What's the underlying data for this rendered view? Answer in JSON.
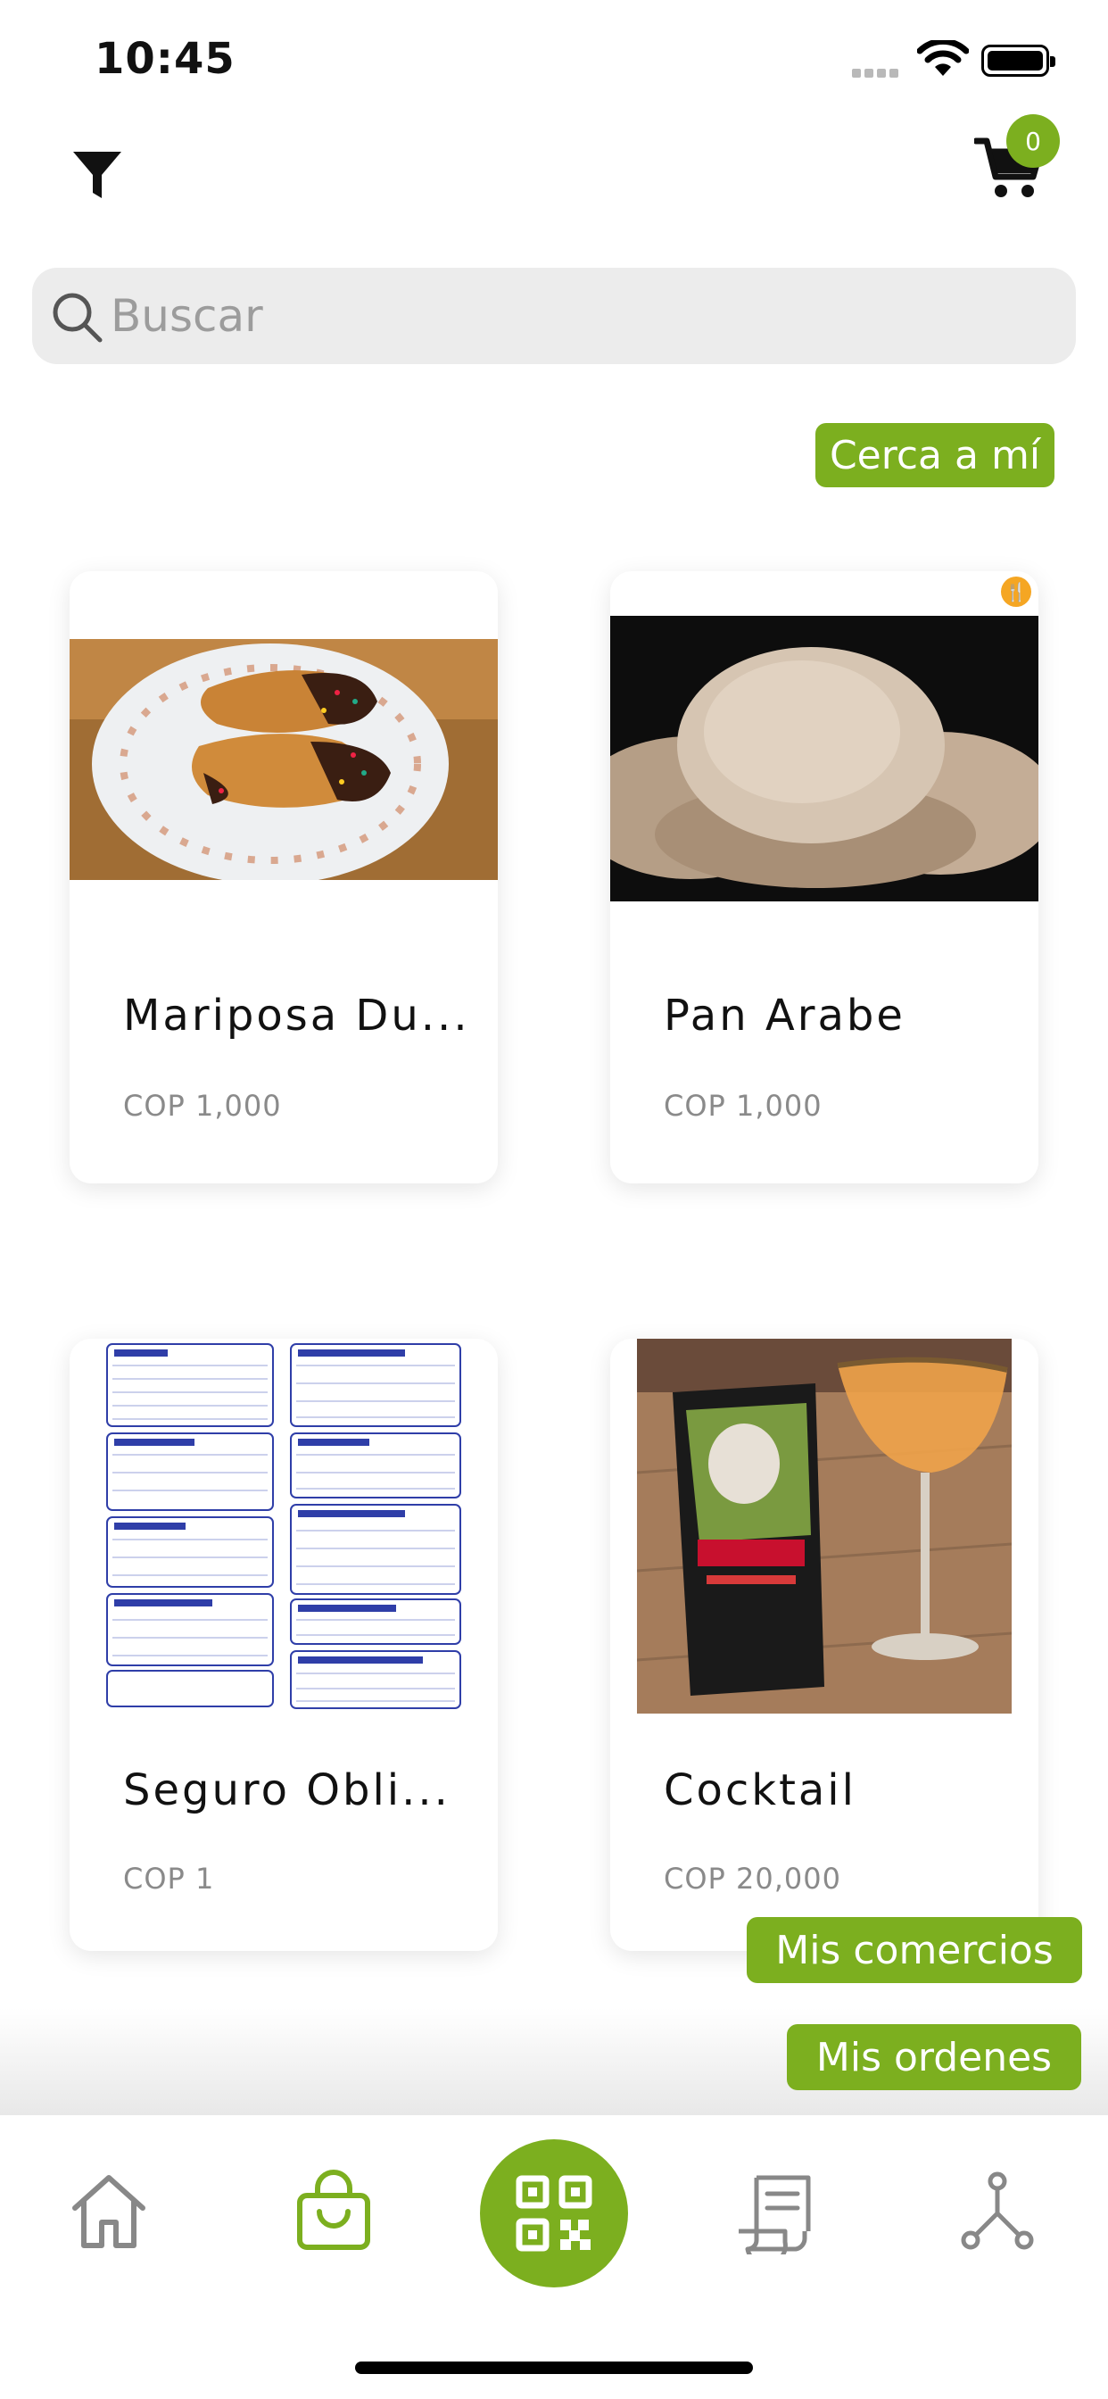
{
  "status_bar": {
    "time": "10:45"
  },
  "header": {
    "cart_count": "0"
  },
  "search": {
    "placeholder": "Buscar",
    "value": ""
  },
  "near_button": {
    "label": "Cerca a mí"
  },
  "products": [
    {
      "title": "Mariposa Du...",
      "price": "COP 1,000"
    },
    {
      "title": "Pan Arabe",
      "price": "COP 1,000"
    },
    {
      "title": "Seguro Obli...",
      "price": "COP 1"
    },
    {
      "title": "Cocktail",
      "price": "COP 20,000"
    }
  ],
  "floating": {
    "mis_comercios": "Mis comercios",
    "mis_ordenes": "Mis ordenes"
  },
  "colors": {
    "accent": "#7caf1f",
    "search_bg": "#ececec"
  },
  "icons": {
    "filter": "filter-icon",
    "cart": "cart-icon",
    "search": "search-icon",
    "nav": [
      "home-icon",
      "shopping-bag-icon",
      "qr-code-icon",
      "receipt-icon",
      "network-icon"
    ]
  }
}
